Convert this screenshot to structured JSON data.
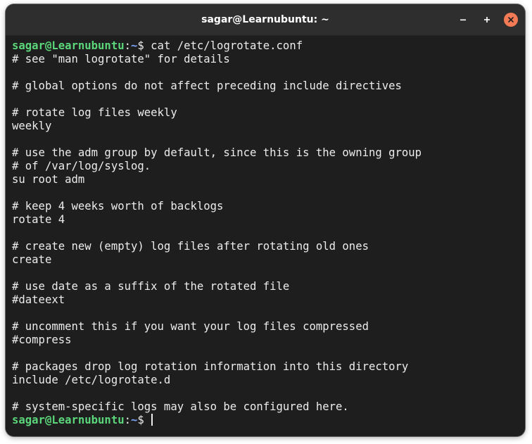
{
  "window": {
    "title": "sagar@Learnubuntu: ~",
    "buttons": [
      "minimize-icon",
      "maximize-icon",
      "close-icon"
    ],
    "close_color": "#f27a55"
  },
  "prompt": {
    "user_host": "sagar@Learnubuntu",
    "separator": ":",
    "path": "~",
    "symbol": "$ "
  },
  "command": "cat /etc/logrotate.conf",
  "output_lines": [
    "# see \"man logrotate\" for details",
    "",
    "# global options do not affect preceding include directives",
    "",
    "# rotate log files weekly",
    "weekly",
    "",
    "# use the adm group by default, since this is the owning group",
    "# of /var/log/syslog.",
    "su root adm",
    "",
    "# keep 4 weeks worth of backlogs",
    "rotate 4",
    "",
    "# create new (empty) log files after rotating old ones",
    "create",
    "",
    "# use date as a suffix of the rotated file",
    "#dateext",
    "",
    "# uncomment this if you want your log files compressed",
    "#compress",
    "",
    "# packages drop log rotation information into this directory",
    "include /etc/logrotate.d",
    "",
    "# system-specific logs may also be configured here."
  ],
  "colors": {
    "prompt_user": "#5bd67a",
    "prompt_path": "#7aa2f7",
    "text": "#ececec",
    "background": "#1e1e1e"
  }
}
